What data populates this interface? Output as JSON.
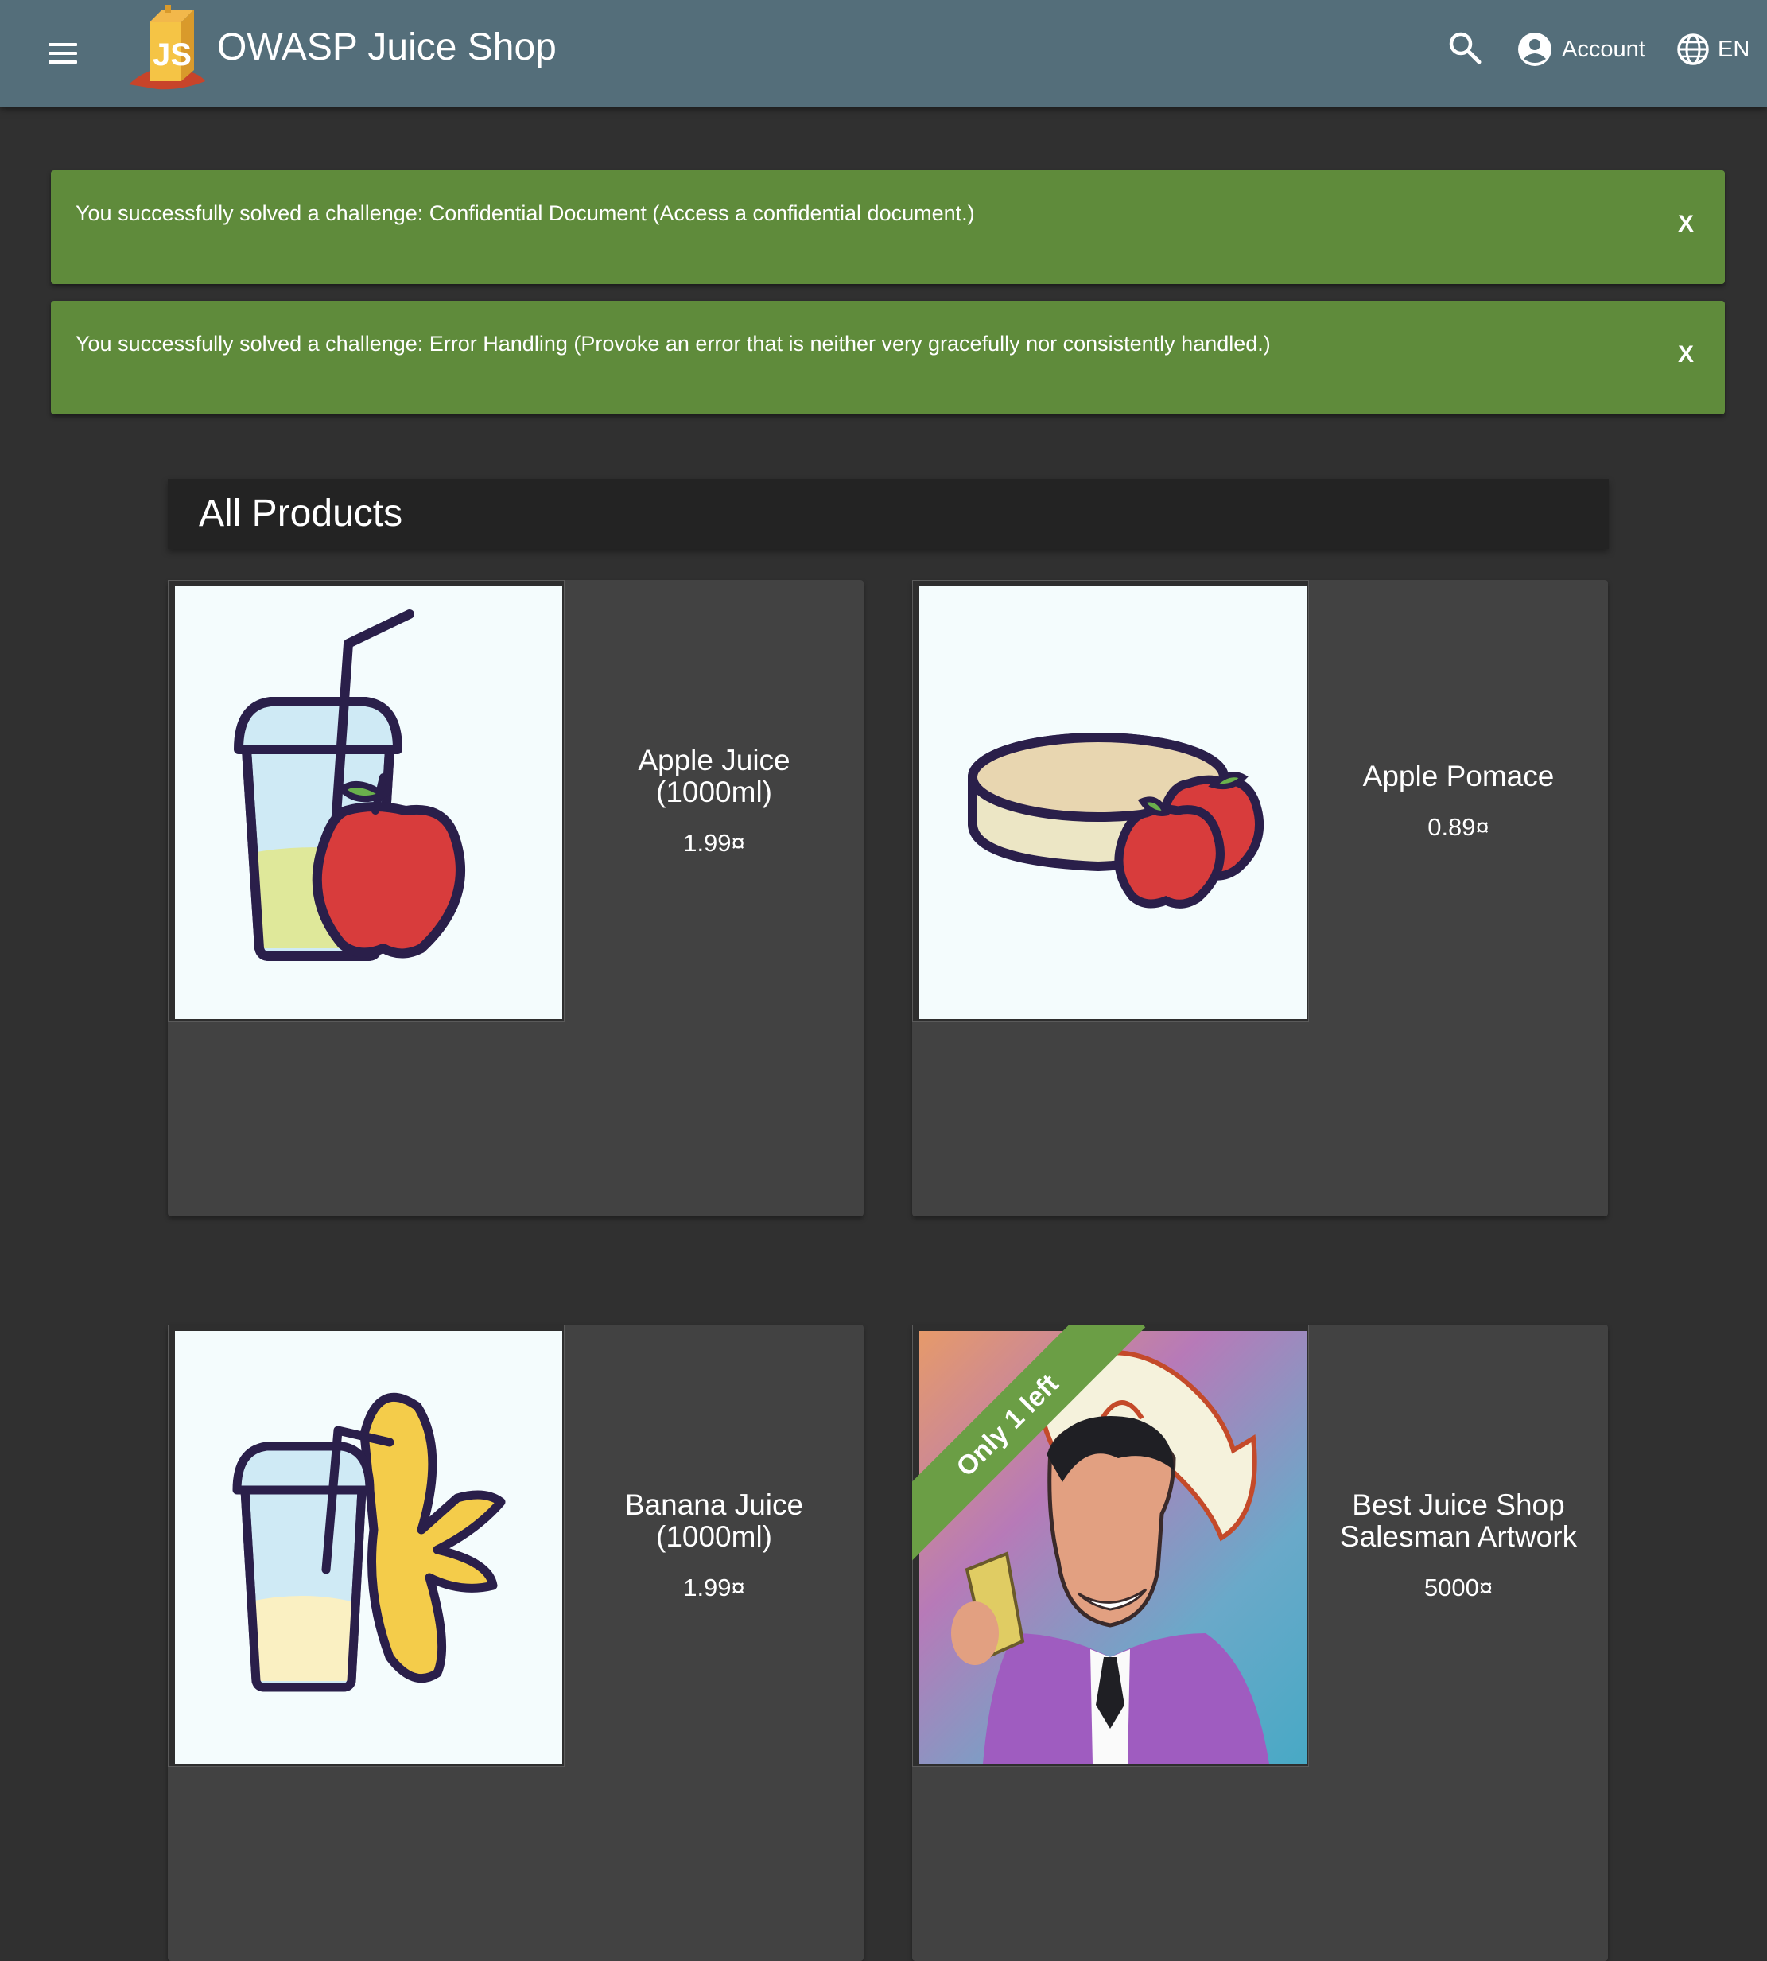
{
  "header": {
    "title": "OWASP Juice Shop",
    "account_label": "Account",
    "language_label": "EN",
    "colors": {
      "toolbar": "#546e7a",
      "background": "#303030"
    }
  },
  "notifications": [
    {
      "message": "You successfully solved a challenge: Confidential Document (Access a confidential document.)",
      "close_label": "X"
    },
    {
      "message": "You successfully solved a challenge: Error Handling (Provoke an error that is neither very gracefully nor consistently handled.)",
      "close_label": "X"
    }
  ],
  "products_section": {
    "title": "All Products"
  },
  "products": [
    {
      "name": "Apple Juice (1000ml)",
      "price": "1.99¤",
      "image": "apple-juice-illustration"
    },
    {
      "name": "Apple Pomace",
      "price": "0.89¤",
      "image": "apple-pomace-illustration"
    },
    {
      "name": "Banana Juice (1000ml)",
      "price": "1.99¤",
      "image": "banana-juice-illustration"
    },
    {
      "name": "Best Juice Shop Salesman Artwork",
      "price": "5000¤",
      "image": "salesman-artwork",
      "ribbon": "Only 1 left"
    }
  ],
  "colors": {
    "success": "#5f8b3b",
    "ribbon": "#6b9e45",
    "card": "#424242"
  }
}
